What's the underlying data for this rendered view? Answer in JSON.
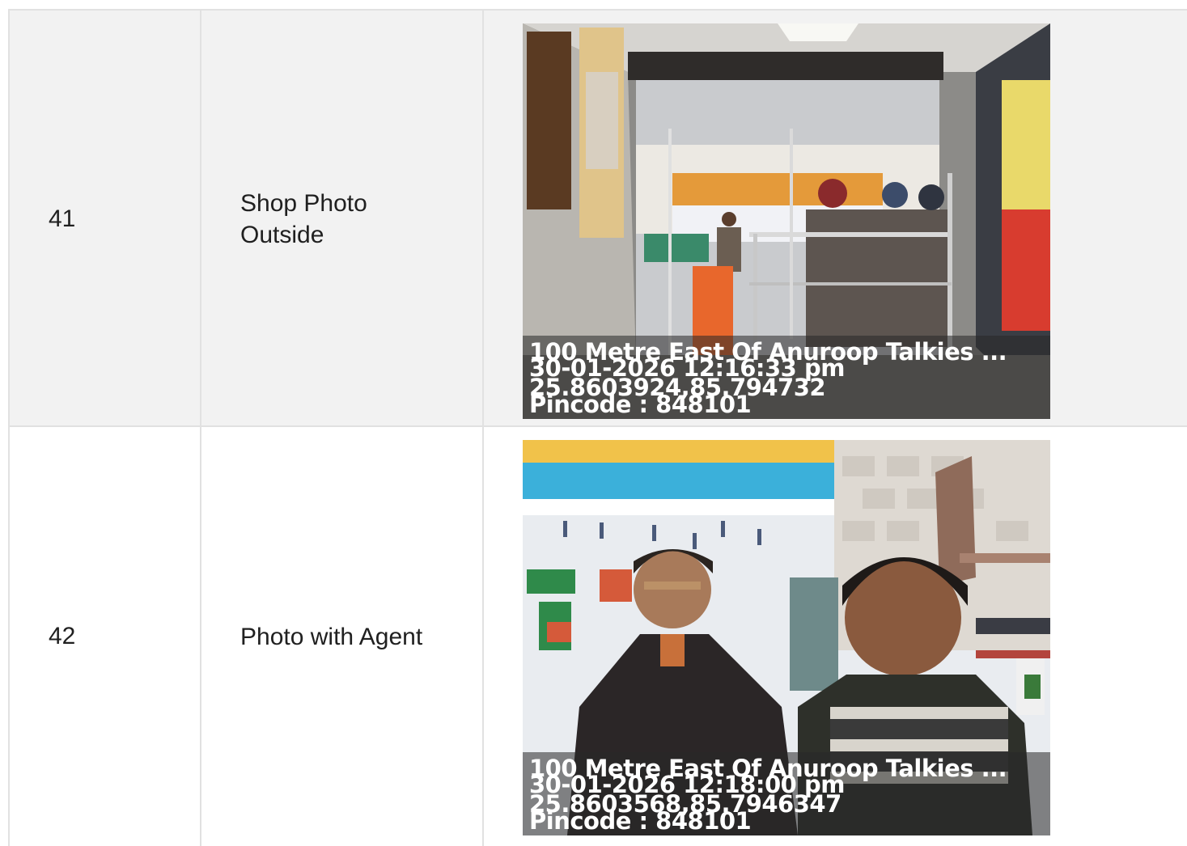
{
  "rows": [
    {
      "index": "41",
      "label": "Shop Photo Outside",
      "photo": {
        "subject": "shop-entrance",
        "stamp": {
          "address": "100 Metre East Of Anuroop Talkies ...",
          "datetime": "30-01-2026 12:16:33 pm",
          "coords": "25.8603924,85.794732",
          "pincode": "Pincode : 848101"
        }
      }
    },
    {
      "index": "42",
      "label": "Photo with Agent",
      "photo": {
        "subject": "selfie-with-agent",
        "stamp": {
          "address": "100 Metre East Of Anuroop Talkies ...",
          "datetime": "30-01-2026 12:18:00 pm",
          "coords": "25.8603568,85.7946347",
          "pincode": "Pincode : 848101"
        }
      }
    }
  ],
  "colors": {
    "row_alt_bg": "#f2f2f2",
    "row_bg": "#ffffff",
    "border": "#e1e1e1",
    "text": "#202020",
    "stamp_text": "#ffffff"
  }
}
